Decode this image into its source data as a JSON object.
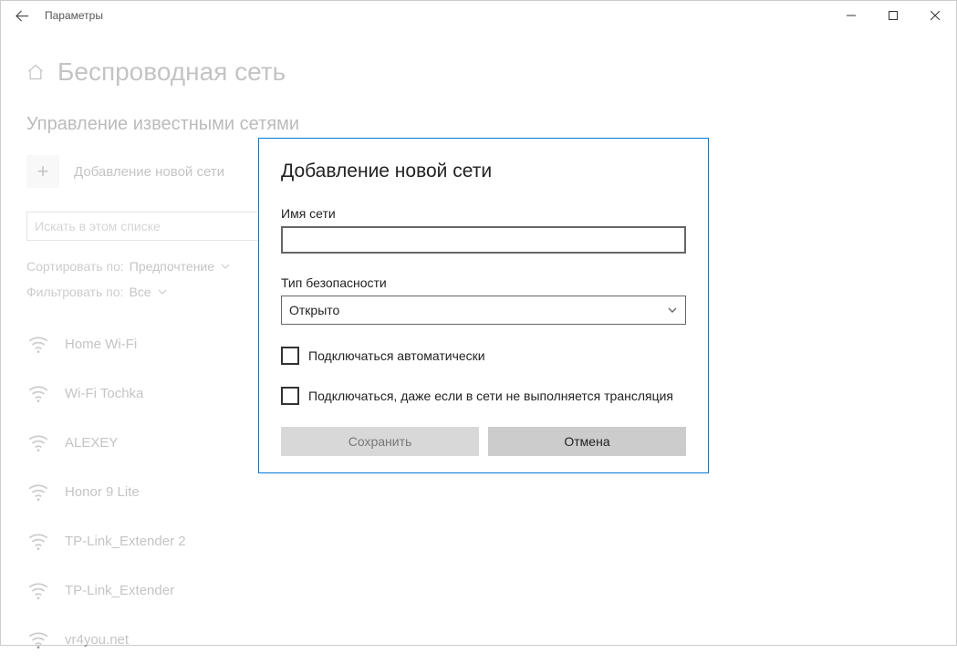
{
  "titlebar": {
    "title": "Параметры"
  },
  "page": {
    "title": "Беспроводная сеть",
    "section": "Управление известными сетями",
    "add_label": "Добавление новой сети",
    "search_placeholder": "Искать в этом списке",
    "sort_label": "Сортировать по:",
    "sort_value": "Предпочтение",
    "filter_label": "Фильтровать по:",
    "filter_value": "Все"
  },
  "networks": [
    {
      "name": "Home Wi-Fi"
    },
    {
      "name": "Wi-Fi Tochka"
    },
    {
      "name": "ALEXEY"
    },
    {
      "name": "Honor 9 Lite"
    },
    {
      "name": "TP-Link_Extender 2"
    },
    {
      "name": "TP-Link_Extender"
    },
    {
      "name": "vr4you.net"
    }
  ],
  "dialog": {
    "title": "Добавление новой сети",
    "name_label": "Имя сети",
    "name_value": "",
    "sec_label": "Тип безопасности",
    "sec_value": "Открыто",
    "auto_label": "Подключаться автоматически",
    "hidden_label": "Подключаться, даже если в сети не выполняется трансляция",
    "save": "Сохранить",
    "cancel": "Отмена"
  }
}
